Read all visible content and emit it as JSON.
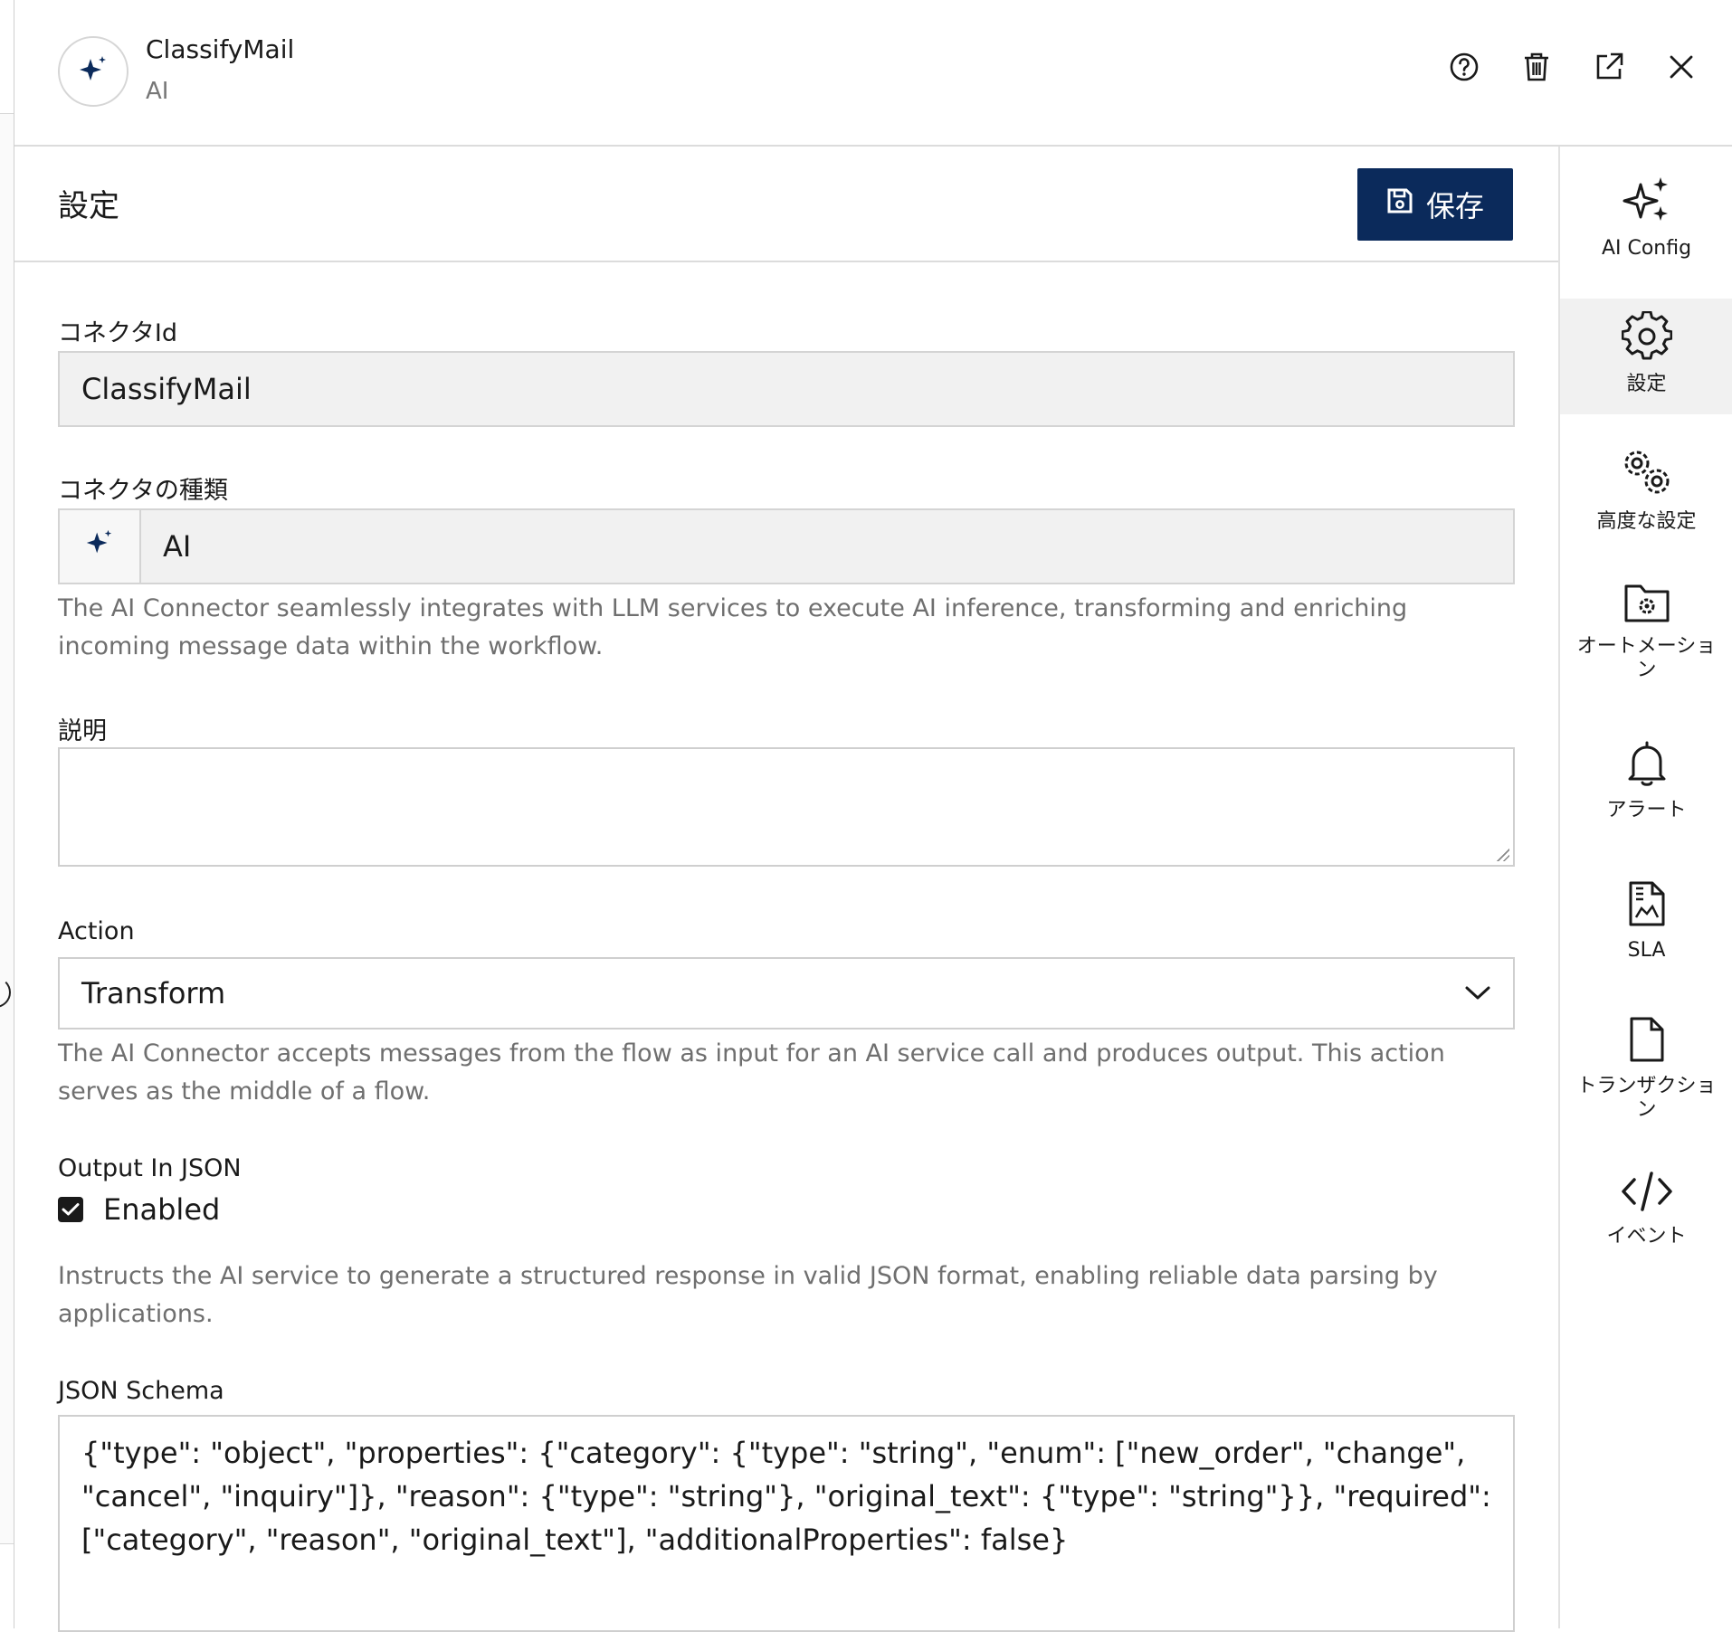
{
  "header": {
    "title": "ClassifyMail",
    "subtitle": "AI",
    "icons": [
      "help-icon",
      "trash-icon",
      "external-link-icon",
      "close-icon"
    ]
  },
  "section": {
    "title": "設定",
    "save_label": "保存"
  },
  "form": {
    "connector_id": {
      "label": "コネクタId",
      "value": "ClassifyMail"
    },
    "connector_type": {
      "label": "コネクタの種類",
      "value": "AI",
      "help": "The AI Connector seamlessly integrates with LLM services to execute AI inference, transforming and enriching incoming message data within the workflow."
    },
    "description": {
      "label": "説明",
      "value": ""
    },
    "action": {
      "label": "Action",
      "value": "Transform",
      "help": "The AI Connector accepts messages from the flow as input for an AI service call and produces output. This action serves as the middle of a flow."
    },
    "output_json": {
      "label": "Output In JSON",
      "checkbox_label": "Enabled",
      "checked": true,
      "help": "Instructs the AI service to generate a structured response in valid JSON format, enabling reliable data parsing by applications."
    },
    "json_schema": {
      "label": "JSON Schema",
      "value": "{\"type\": \"object\", \"properties\": {\"category\": {\"type\": \"string\", \"enum\": [\"new_order\", \"change\", \"cancel\", \"inquiry\"]}, \"reason\": {\"type\": \"string\"}, \"original_text\": {\"type\": \"string\"}}, \"required\": [\"category\", \"reason\", \"original_text\"], \"additionalProperties\": false}"
    }
  },
  "rightnav": {
    "items": [
      {
        "label": "AI Config",
        "icon": "sparkles-icon",
        "active": false
      },
      {
        "label": "設定",
        "icon": "gear-icon",
        "active": true
      },
      {
        "label": "高度な設定",
        "icon": "gears-icon",
        "active": false
      },
      {
        "label": "オートメーション",
        "icon": "folder-gear-icon",
        "active": false
      },
      {
        "label": "アラート",
        "icon": "bell-icon",
        "active": false
      },
      {
        "label": "SLA",
        "icon": "document-chart-icon",
        "active": false
      },
      {
        "label": "トランザクション",
        "icon": "document-icon",
        "active": false
      },
      {
        "label": "イベント",
        "icon": "code-icon",
        "active": false
      }
    ]
  },
  "colors": {
    "primary": "#0b2a5b",
    "accent_sparkle": "#0b2a5b",
    "readonly_bg": "#f1f1f1",
    "help_text": "#6f6f6f"
  }
}
